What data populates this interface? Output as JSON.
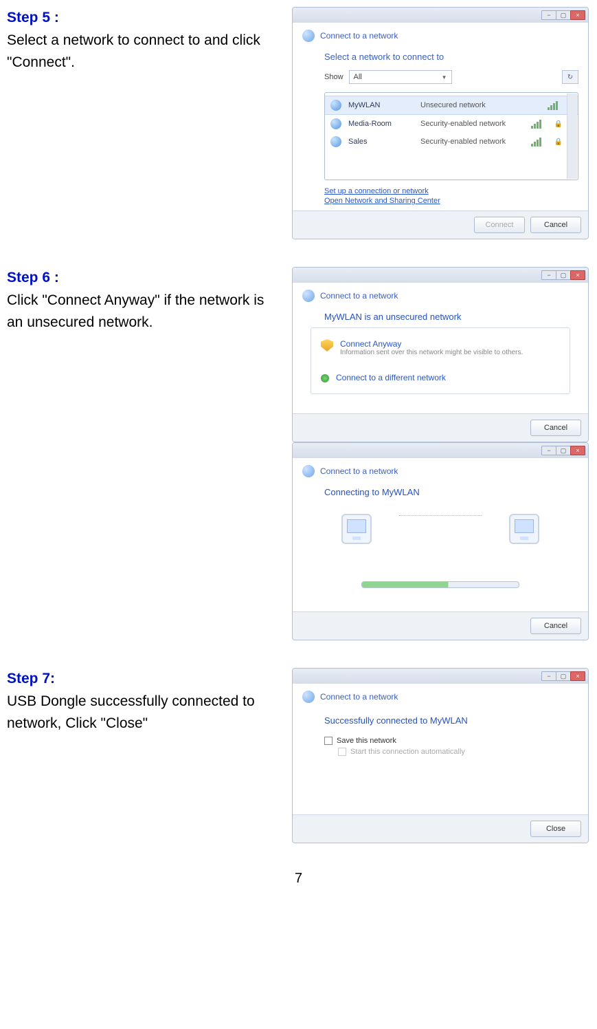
{
  "step5": {
    "title": "Step 5 :",
    "text": "Select a network to connect to and click \"Connect\".",
    "win_title": "Connect to a network",
    "prompt": "Select a network to connect to",
    "show_label": "Show",
    "show_value": "All",
    "networks": [
      {
        "name": "MyWLAN",
        "desc": "Unsecured network",
        "lock": false,
        "selected": true
      },
      {
        "name": "Media-Room",
        "desc": "Security-enabled network",
        "lock": true,
        "selected": false
      },
      {
        "name": "Sales",
        "desc": "Security-enabled network",
        "lock": true,
        "selected": false
      }
    ],
    "link1": "Set up a connection or network",
    "link2": "Open Network and Sharing Center",
    "btn_connect": "Connect",
    "btn_cancel": "Cancel"
  },
  "step6": {
    "title": "Step 6 :",
    "text": "Click \"Connect Anyway\" if the network is an unsecured network.",
    "winA": {
      "hdr": "Connect to a network",
      "headline": "MyWLAN is an unsecured network",
      "opt1_title": "Connect Anyway",
      "opt1_sub": "Information sent over this network might be visible to others.",
      "opt2_title": "Connect to a different network",
      "btn_cancel": "Cancel"
    },
    "winB": {
      "hdr": "Connect to a network",
      "headline": "Connecting to MyWLAN",
      "btn_cancel": "Cancel"
    }
  },
  "step7": {
    "title": "Step 7:",
    "text": "USB Dongle successfully connected to network, Click \"Close\"",
    "hdr": "Connect to a network",
    "headline": "Successfully connected to MyWLAN",
    "save_label": "Save this network",
    "auto_label": "Start this connection automatically",
    "btn_close": "Close"
  },
  "page_number": "7"
}
